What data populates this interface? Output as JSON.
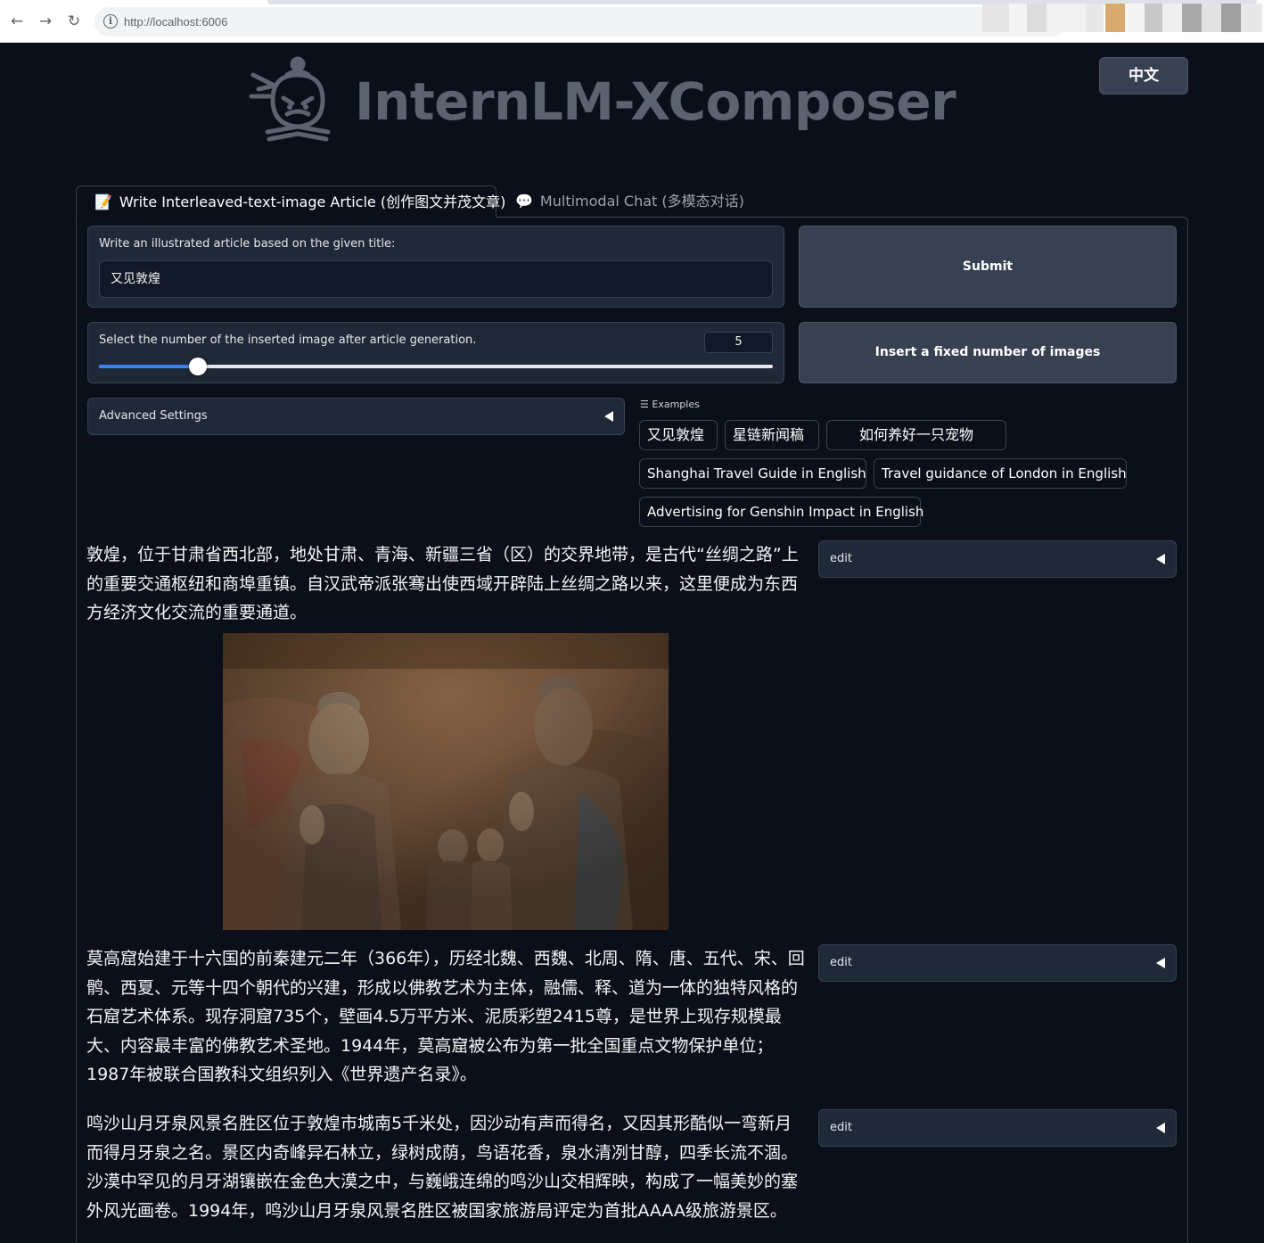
{
  "browser": {
    "url": "http://localhost:6006",
    "back_glyph": "←",
    "forward_glyph": "→",
    "reload_glyph": "↻",
    "info_glyph": "i"
  },
  "header": {
    "brand": "InternLM-XComposer",
    "lang_button": "中文"
  },
  "tabs": [
    {
      "icon": "📝",
      "label": "Write Interleaved-text-image Article (创作图文并茂文章)"
    },
    {
      "icon": "💬",
      "label": "Multimodal Chat (多模态对话)"
    }
  ],
  "title_input": {
    "label": "Write an illustrated article based on the given title:",
    "value": "又见敦煌"
  },
  "image_count": {
    "label": "Select the number of the inserted image after article generation.",
    "value": "5",
    "slider_fraction": 0.147
  },
  "buttons": {
    "submit": "Submit",
    "insert_fixed": "Insert a fixed number of images"
  },
  "advanced": {
    "label": "Advanced Settings"
  },
  "examples": {
    "label": "Examples",
    "icon": "☰",
    "items": [
      "又见敦煌",
      "星链新闻稿",
      "如何养好一只宠物",
      "Shanghai Travel Guide in English",
      "Travel guidance of London in English",
      "Advertising for Genshin Impact in English"
    ]
  },
  "article": {
    "paragraphs": [
      "敦煌，位于甘肃省西北部，地处甘肃、青海、新疆三省（区）的交界地带，是古代“丝绸之路”上的重要交通枢纽和商埠重镇。自汉武帝派张骞出使西域开辟陆上丝绸之路以来，这里便成为东西方经济文化交流的重要通道。",
      "莫高窟始建于十六国的前秦建元二年（366年），历经北魏、西魏、北周、隋、唐、五代、宋、回鹘、西夏、元等十四个朝代的兴建，形成以佛教艺术为主体，融儒、释、道为一体的独特风格的石窟艺术体系。现存洞窟735个，壁画4.5万平方米、泥质彩塑2415尊，是世界上现存规模最大、内容最丰富的佛教艺术圣地。1944年，莫高窟被公布为第一批全国重点文物保护单位；1987年被联合国教科文组织列入《世界遗产名录》。",
      "鸣沙山月牙泉风景名胜区位于敦煌市城南5千米处，因沙动有声而得名，又因其形酷似一弯新月而得月牙泉之名。景区内奇峰异石林立，绿树成荫，鸟语花香，泉水清冽甘醇，四季长流不涸。沙漠中罕见的月牙湖镶嵌在金色大漠之中，与巍峨连绵的鸣沙山交相辉映，构成了一幅美妙的塞外风光画卷。1994年，鸣沙山月牙泉风景名胜区被国家旅游局评定为首批AAAA级旅游景区。"
    ],
    "edit_label": "edit"
  },
  "colors": {
    "background": "#0b0f19",
    "panel": "#1f2937",
    "border": "#374151",
    "button": "#374151",
    "slider_accent": "#3b82f6",
    "brand_text": "#5b6270"
  }
}
